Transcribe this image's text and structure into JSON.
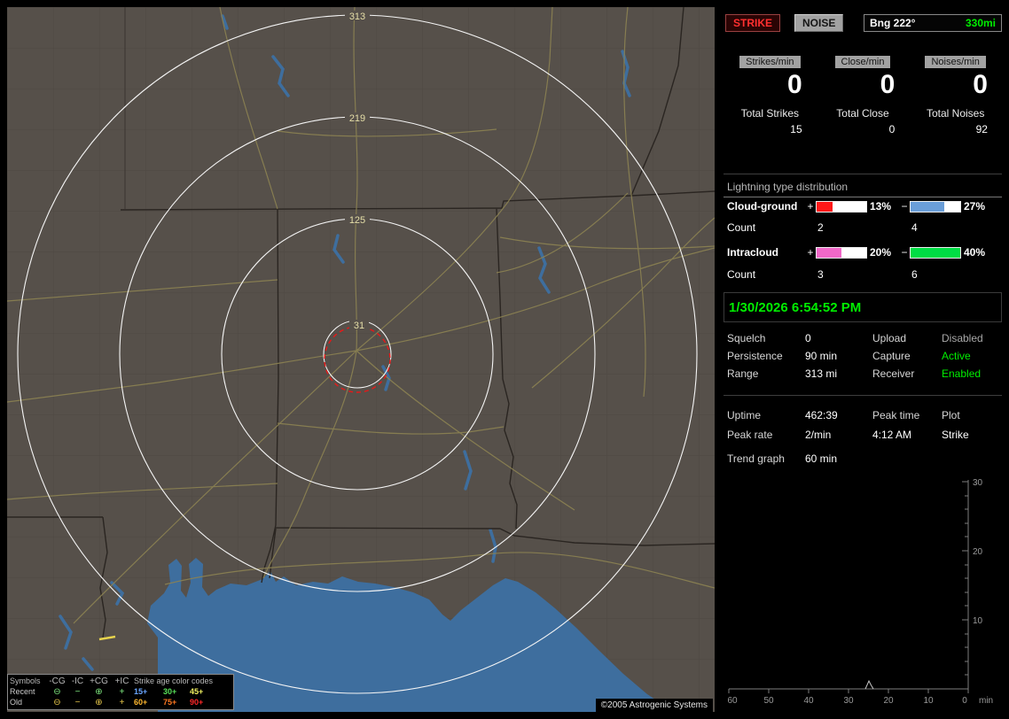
{
  "map": {
    "ring_labels": [
      "313",
      "219",
      "125",
      "31"
    ],
    "legend": {
      "col_symbols": "Symbols",
      "col_cg_neg": "-CG",
      "col_ic_neg": "-IC",
      "col_cg_pos": "+CG",
      "col_ic_pos": "+IC",
      "age_title": "Strike age color codes",
      "recent_label": "Recent",
      "old_label": "Old",
      "sym_cg_neg": "⊖",
      "sym_ic_neg": "−",
      "sym_cg_pos": "⊕",
      "sym_ic_pos": "+",
      "recent_ages": [
        "15+",
        "30+",
        "45+"
      ],
      "old_ages": [
        "60+",
        "75+",
        "90+"
      ]
    },
    "copyright": "©2005 Astrogenic Systems"
  },
  "sidebar": {
    "strike_button": "STRIKE",
    "noise_button": "NOISE",
    "bearing_label": "Bng 222°",
    "bearing_range": "330mi",
    "rates": [
      {
        "label": "Strikes/min",
        "value": "0",
        "total_label": "Total Strikes",
        "total_value": "15"
      },
      {
        "label": "Close/min",
        "value": "0",
        "total_label": "Total Close",
        "total_value": "0"
      },
      {
        "label": "Noises/min",
        "value": "0",
        "total_label": "Total Noises",
        "total_value": "92"
      }
    ],
    "distribution": {
      "title": "Lightning type distribution",
      "rows": [
        {
          "name": "Cloud-ground",
          "plus": "+",
          "minus": "−",
          "pos_pct": "13%",
          "neg_pct": "27%",
          "pos_fill": 33,
          "neg_fill": 68,
          "count_label": "Count",
          "pos_count": "2",
          "neg_count": "4"
        },
        {
          "name": "Intracloud",
          "plus": "+",
          "minus": "−",
          "pos_pct": "20%",
          "neg_pct": "40%",
          "pos_fill": 50,
          "neg_fill": 100,
          "count_label": "Count",
          "pos_count": "3",
          "neg_count": "6"
        }
      ]
    },
    "timestamp": "1/30/2026 6:54:52 PM",
    "settings": {
      "squelch_label": "Squelch",
      "squelch": "0",
      "upload_label": "Upload",
      "upload": "Disabled",
      "persistence_label": "Persistence",
      "persistence": "90 min",
      "capture_label": "Capture",
      "capture": "Active",
      "range_label": "Range",
      "range": "313 mi",
      "receiver_label": "Receiver",
      "receiver": "Enabled"
    },
    "status": {
      "uptime_label": "Uptime",
      "uptime": "462:39",
      "peak_time_label": "Peak time",
      "peak_time": "4:12 AM",
      "plot_label": "Plot",
      "plot": "Strike",
      "peak_rate_label": "Peak rate",
      "peak_rate": "2/min"
    },
    "trend": {
      "label": "Trend graph",
      "window": "60 min",
      "y_ticks": [
        "30",
        "20",
        "10"
      ],
      "x_ticks": [
        "60",
        "50",
        "40",
        "30",
        "20",
        "10",
        "0"
      ],
      "x_unit": "min",
      "spike": {
        "minutes_ago": 26,
        "value": 2
      }
    }
  },
  "colors": {
    "accent_green": "#00ee00",
    "strike_red": "#ff3030",
    "cg_pos_bar": "#ff1818",
    "cg_neg_bar": "#6a9ed8",
    "ic_pos_bar": "#f068c8",
    "ic_neg_bar": "#00dd44",
    "sym_recent": "#7fe87f",
    "sym_old": "#e8c84a",
    "age_15": "#6aa6ff",
    "age_30": "#58e058",
    "age_45": "#f0f060",
    "age_60": "#ffb830",
    "age_75": "#ff7820",
    "age_90": "#ff2828"
  }
}
